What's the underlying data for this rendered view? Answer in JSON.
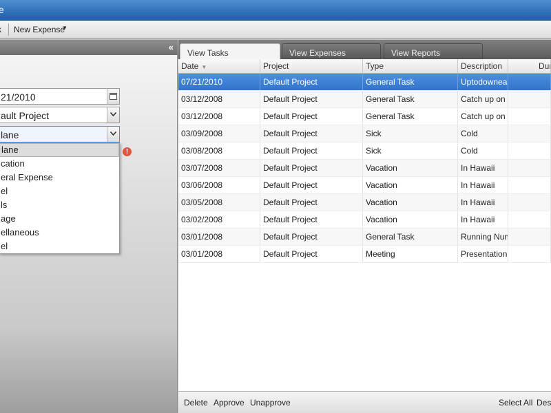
{
  "window": {
    "title": "e"
  },
  "toolbar": {
    "prev_label": "k",
    "new_expense_label": "New Expense",
    "new_expense_caret": "▼"
  },
  "left_panel": {
    "collapse_glyph": "«",
    "date_value": "21/2010",
    "project_value": "ault Project",
    "category_value": "lane",
    "error_glyph": "!",
    "category_options": [
      "lane",
      "cation",
      "eral Expense",
      "el",
      "ls",
      "age",
      "ellaneous",
      "el"
    ],
    "selected_option_index": 0
  },
  "tabs": [
    {
      "label": "View Tasks",
      "active": true
    },
    {
      "label": "View Expenses",
      "active": false
    },
    {
      "label": "View Reports",
      "active": false
    }
  ],
  "grid": {
    "columns": [
      "Date",
      "Project",
      "Type",
      "Description",
      "Dur"
    ],
    "sort_glyph": "▼",
    "rows": [
      {
        "date": "07/21/2010",
        "project": "Default Project",
        "type": "General Task",
        "description": "Uptodowneap",
        "selected": true
      },
      {
        "date": "03/12/2008",
        "project": "Default Project",
        "type": "General Task",
        "description": "Catch up on e"
      },
      {
        "date": "03/12/2008",
        "project": "Default Project",
        "type": "General Task",
        "description": "Catch up on w"
      },
      {
        "date": "03/09/2008",
        "project": "Default Project",
        "type": "Sick",
        "description": "Cold"
      },
      {
        "date": "03/08/2008",
        "project": "Default Project",
        "type": "Sick",
        "description": "Cold"
      },
      {
        "date": "03/07/2008",
        "project": "Default Project",
        "type": "Vacation",
        "description": "In Hawaii"
      },
      {
        "date": "03/06/2008",
        "project": "Default Project",
        "type": "Vacation",
        "description": "In Hawaii"
      },
      {
        "date": "03/05/2008",
        "project": "Default Project",
        "type": "Vacation",
        "description": "In Hawaii"
      },
      {
        "date": "03/02/2008",
        "project": "Default Project",
        "type": "Vacation",
        "description": "In Hawaii"
      },
      {
        "date": "03/01/2008",
        "project": "Default Project",
        "type": "General Task",
        "description": "Running Numb"
      },
      {
        "date": "03/01/2008",
        "project": "Default Project",
        "type": "Meeting",
        "description": "Presentation"
      }
    ]
  },
  "bottom_bar": {
    "delete_label": "Delete",
    "approve_label": "Approve",
    "unapprove_label": "Unapprove",
    "select_all_label": "Select All",
    "deselect_label": "Dese"
  },
  "colors": {
    "selection": "#3a7ed0",
    "titlebar": "#2f6fb8",
    "error": "#e0553f"
  }
}
